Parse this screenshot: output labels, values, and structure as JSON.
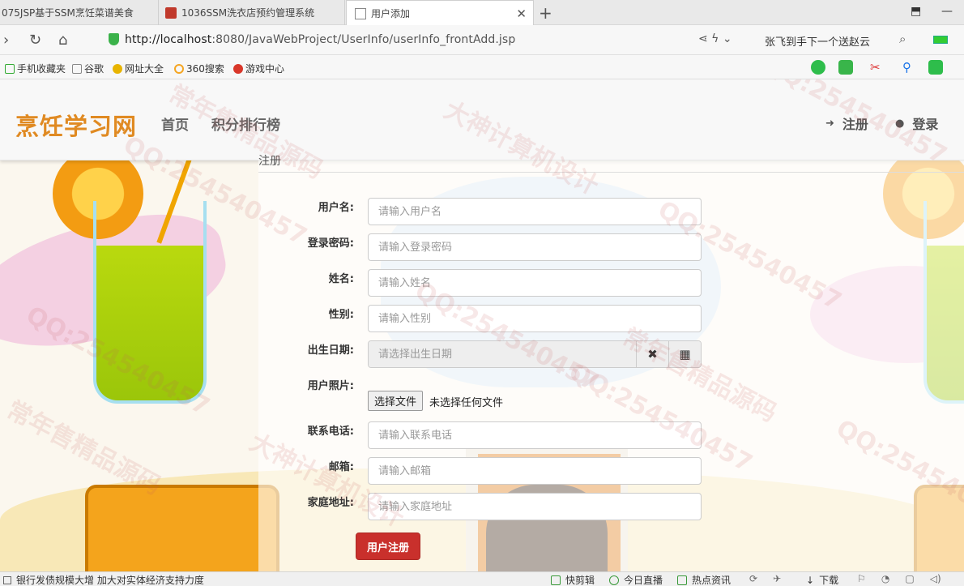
{
  "browser": {
    "tabs": [
      {
        "title": "075JSP基于SSM烹饪菜谱美食"
      },
      {
        "title": "1036SSM洗衣店预约管理系统"
      },
      {
        "title": "用户添加"
      }
    ],
    "url_host": "http://localhost",
    "url_path": ":8080/JavaWebProject/UserInfo/userInfo_frontAdd.jsp",
    "search_hint": "张飞到手下一个送赵云"
  },
  "bookmarks": [
    {
      "label": "手机收藏夹"
    },
    {
      "label": "谷歌"
    },
    {
      "label": "网址大全"
    },
    {
      "label": "360搜索"
    },
    {
      "label": "游戏中心"
    }
  ],
  "site": {
    "brand": "烹饪学习网",
    "nav": {
      "home": "首页",
      "ranking": "积分排行榜"
    },
    "register": "注册",
    "login": "登录"
  },
  "panel": {
    "title": "注册"
  },
  "form": {
    "username": {
      "label": "用户名:",
      "placeholder": "请输入用户名"
    },
    "password": {
      "label": "登录密码:",
      "placeholder": "请输入登录密码"
    },
    "name": {
      "label": "姓名:",
      "placeholder": "请输入姓名"
    },
    "gender": {
      "label": "性别:",
      "placeholder": "请输入性别"
    },
    "birth": {
      "label": "出生日期:",
      "placeholder": "请选择出生日期"
    },
    "photo": {
      "label": "用户照片:",
      "button": "选择文件",
      "status": "未选择任何文件"
    },
    "phone": {
      "label": "联系电话:",
      "placeholder": "请输入联系电话"
    },
    "email": {
      "label": "邮箱:",
      "placeholder": "请输入邮箱"
    },
    "address": {
      "label": "家庭地址:",
      "placeholder": "请输入家庭地址"
    },
    "submit": "用户注册"
  },
  "watermarks": [
    "QQ:254540457",
    "大神计算机设计",
    "常年售精品源码"
  ],
  "statusbar": {
    "news": "银行发债规模大增 加大对实体经济支持力度",
    "items": [
      "快剪辑",
      "今日直播",
      "热点资讯",
      "下载"
    ]
  },
  "colors": {
    "brand": "#e08a22",
    "submit": "#c9302c"
  }
}
